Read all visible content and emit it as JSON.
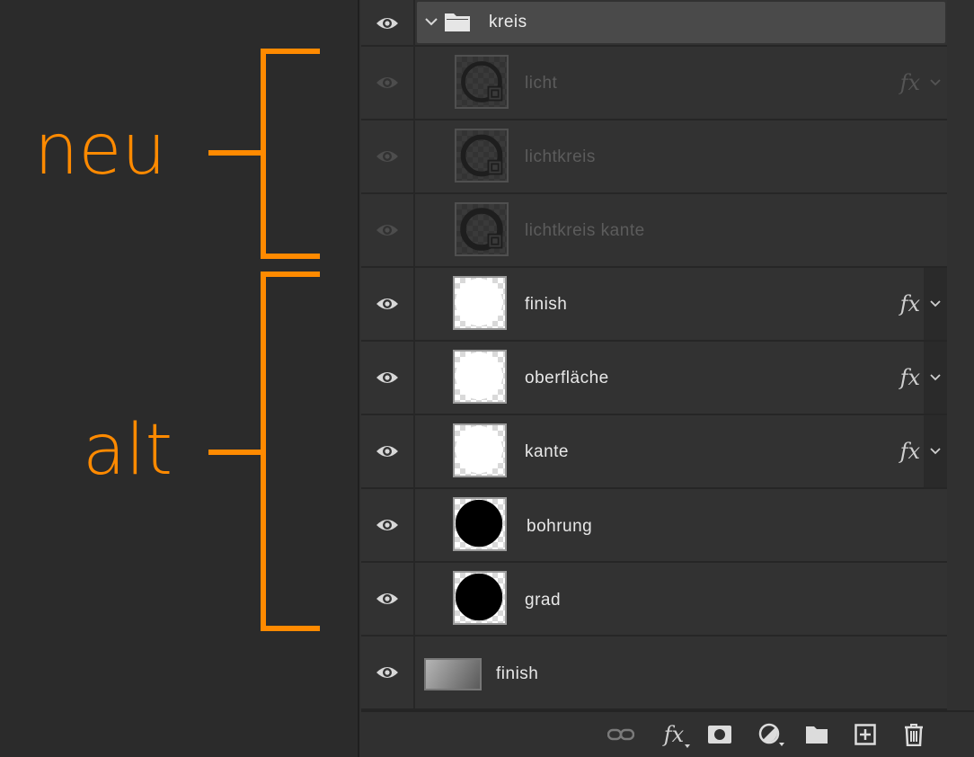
{
  "annotations": {
    "new_label": "neu",
    "old_label": "alt",
    "accent_color": "#ff8a00"
  },
  "group": {
    "name": "kreis",
    "expanded": true,
    "icon": "folder-icon"
  },
  "layers": [
    {
      "name": "licht",
      "visible": false,
      "fx": true,
      "thumb": "ring-dim"
    },
    {
      "name": "lichtkreis",
      "visible": false,
      "fx": false,
      "thumb": "ring-dim"
    },
    {
      "name": "lichtkreis kante",
      "visible": false,
      "fx": false,
      "thumb": "ring-dim"
    },
    {
      "name": "finish",
      "visible": true,
      "fx": true,
      "thumb": "white-circle"
    },
    {
      "name": "oberfläche",
      "visible": true,
      "fx": true,
      "thumb": "white-circle"
    },
    {
      "name": "kante",
      "visible": true,
      "fx": true,
      "thumb": "white-circle"
    },
    {
      "name": "bohrung",
      "visible": true,
      "fx": false,
      "thumb": "black-circle"
    },
    {
      "name": "grad",
      "visible": true,
      "fx": false,
      "thumb": "black-circle"
    },
    {
      "name": "finish",
      "visible": true,
      "fx": false,
      "thumb": "gradient"
    }
  ],
  "fx_label": "fx",
  "footer_fx_label": "fx",
  "footer_icons": [
    "link-icon",
    "fx-icon",
    "mask-icon",
    "adjustment-icon",
    "new-group-icon",
    "new-layer-icon",
    "trash-icon"
  ]
}
